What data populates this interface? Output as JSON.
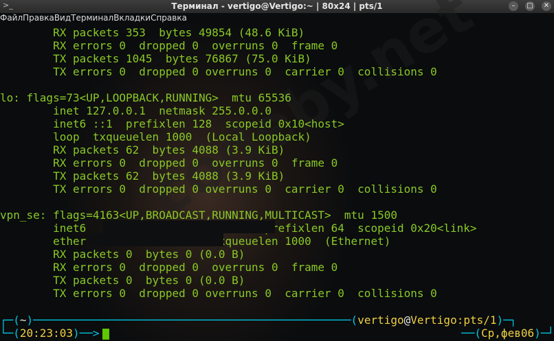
{
  "window": {
    "title": "Терминал - vertigo@Vertigo:~ | 80x24 | pts/1",
    "icon": "terminal-icon"
  },
  "menu": [
    "Файл",
    "Правка",
    "Вид",
    "Терминал",
    "Вкладки",
    "Справка"
  ],
  "terminal": {
    "lines": [
      "        RX packets 353  bytes 49854 (48.6 KiB)",
      "        RX errors 0  dropped 0  overruns 0  frame 0",
      "        TX packets 1045  bytes 76867 (75.0 KiB)",
      "        TX errors 0  dropped 0 overruns 0  carrier 0  collisions 0",
      "",
      "lo: flags=73<UP,LOOPBACK,RUNNING>  mtu 65536",
      "        inet 127.0.0.1  netmask 255.0.0.0",
      "        inet6 ::1  prefixlen 128  scopeid 0x10<host>",
      "        loop  txqueuelen 1000  (Local Loopback)",
      "        RX packets 62  bytes 4088 (3.9 KiB)",
      "        RX errors 0  dropped 0  overruns 0  frame 0",
      "        TX packets 62  bytes 4088 (3.9 KiB)",
      "        TX errors 0  dropped 0 overruns 0  carrier 0  collisions 0",
      "",
      "vpn_se: flags=4163<UP,BROADCAST,RUNNING,MULTICAST>  mtu 1500",
      "        inet6                           prefixlen 64  scopeid 0x20<link>",
      "        ether                   txqueuelen 1000  (Ethernet)",
      "        RX packets 0  bytes 0 (0.0 B)",
      "        RX errors 0  dropped 0  overruns 0  frame 0",
      "        TX packets 0  bytes 0 (0.0 B)",
      "        TX errors 0  dropped 0 overruns 0  carrier 0  collisions 0"
    ]
  },
  "prompt": {
    "dir": "~",
    "time": "20:23:03",
    "user": "vertigo",
    "at": "@",
    "host": "Vertigo",
    "tty": ":pts/1",
    "date": "Ср,фев06"
  },
  "watermark": "codeby.net",
  "colors": {
    "text": "#8ac926",
    "prompt": "#00c8e0",
    "accent": "#f0d040"
  }
}
